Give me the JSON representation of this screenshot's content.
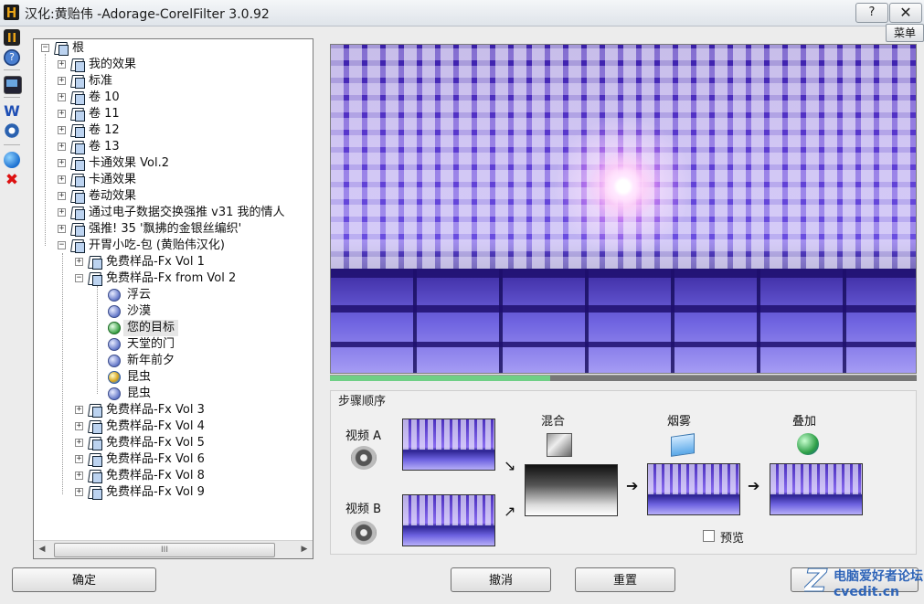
{
  "window": {
    "title": "汉化:黄贻伟 -Adorage-CorelFilter 3.0.92",
    "help_label": "?",
    "close_label": "✕",
    "menu_label": "菜单"
  },
  "tree": {
    "root": "根",
    "items": [
      {
        "label": "我的效果",
        "expander": "+"
      },
      {
        "label": "标准",
        "expander": "+"
      },
      {
        "label": "卷 10",
        "expander": "+"
      },
      {
        "label": "卷 11",
        "expander": "+"
      },
      {
        "label": "卷 12",
        "expander": "+"
      },
      {
        "label": "卷 13",
        "expander": "+"
      },
      {
        "label": "卡通效果 Vol.2",
        "expander": "+"
      },
      {
        "label": "卡通效果",
        "expander": "+"
      },
      {
        "label": "卷动效果",
        "expander": "+"
      },
      {
        "label": "通过电子数据交换强推 v31 我的情人",
        "expander": "+"
      },
      {
        "label": "强推! 35 '飘拂的金银丝编织'",
        "expander": "+"
      },
      {
        "label": "开胃小吃-包 (黄贻伟汉化)",
        "expander": "−"
      }
    ],
    "sub_items": [
      {
        "label": "免费样品-Fx Vol 1",
        "expander": "+"
      },
      {
        "label": "免费样品-Fx from Vol 2",
        "expander": "−"
      }
    ],
    "effects": [
      {
        "label": "浮云",
        "icon": "effect-icon"
      },
      {
        "label": "沙漠",
        "icon": "effect-icon"
      },
      {
        "label": "您的目标",
        "icon": "effect-icon-green",
        "selected": true
      },
      {
        "label": "天堂的门",
        "icon": "effect-icon"
      },
      {
        "label": "新年前夕",
        "icon": "effect-icon"
      },
      {
        "label": "昆虫",
        "icon": "effect-icon-gold"
      },
      {
        "label": "昆虫",
        "icon": "effect-icon"
      }
    ],
    "more_sub_items": [
      {
        "label": "免费样品-Fx Vol 3",
        "expander": "+"
      },
      {
        "label": "免费样品-Fx Vol 4",
        "expander": "+"
      },
      {
        "label": "免费样品-Fx Vol 5",
        "expander": "+"
      },
      {
        "label": "免费样品-Fx Vol 6",
        "expander": "+"
      },
      {
        "label": "免费样品-Fx Vol 8",
        "expander": "+"
      },
      {
        "label": "免费样品-Fx Vol 9",
        "expander": "+"
      }
    ],
    "scroll_grip": "III",
    "scroll_left": "◀",
    "scroll_right": "▶"
  },
  "preview": {
    "progress_fraction": 0.375
  },
  "steps": {
    "title": "步骤顺序",
    "video_a": "视频 A",
    "video_b": "视频 B",
    "blend": "混合",
    "fog": "烟雾",
    "overlay": "叠加",
    "preview_label": "预览",
    "arrow_down": "↘",
    "arrow_up": "↗",
    "arrow_right": "➔"
  },
  "buttons": {
    "ok": "确定",
    "cancel": "撤消",
    "reset": "重置"
  },
  "watermark": {
    "text": "电脑爱好者论坛",
    "url": "cvedit.cn"
  }
}
